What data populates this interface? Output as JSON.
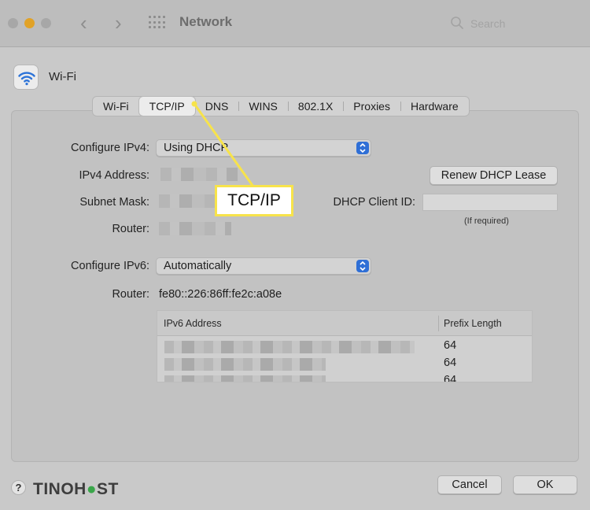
{
  "window": {
    "title": "Network",
    "search_placeholder": "Search"
  },
  "service": {
    "name": "Wi-Fi"
  },
  "tabs": [
    {
      "label": "Wi-Fi"
    },
    {
      "label": "TCP/IP"
    },
    {
      "label": "DNS"
    },
    {
      "label": "WINS"
    },
    {
      "label": "802.1X"
    },
    {
      "label": "Proxies"
    },
    {
      "label": "Hardware"
    }
  ],
  "active_tab": "TCP/IP",
  "ipv4": {
    "configure_label": "Configure IPv4:",
    "configure_value": "Using DHCP",
    "address_label": "IPv4 Address:",
    "subnet_label": "Subnet Mask:",
    "router_label": "Router:"
  },
  "dhcp": {
    "renew_button": "Renew DHCP Lease",
    "client_id_label": "DHCP Client ID:",
    "client_id_hint": "(If required)"
  },
  "ipv6": {
    "configure_label": "Configure IPv6:",
    "configure_value": "Automatically",
    "router_label": "Router:",
    "router_value": "fe80::226:86ff:fe2c:a08e",
    "table": {
      "col_address": "IPv6 Address",
      "col_prefix": "Prefix Length",
      "rows": [
        {
          "prefix": "64"
        },
        {
          "prefix": "64"
        },
        {
          "prefix": "64"
        }
      ]
    }
  },
  "callout": {
    "text": "TCP/IP",
    "color": "#f7e34b"
  },
  "footer": {
    "help": "?",
    "cancel_button": "Cancel",
    "ok_button": "OK",
    "logo_part1": "TINO",
    "logo_part2": "H",
    "logo_part3": "ST"
  }
}
